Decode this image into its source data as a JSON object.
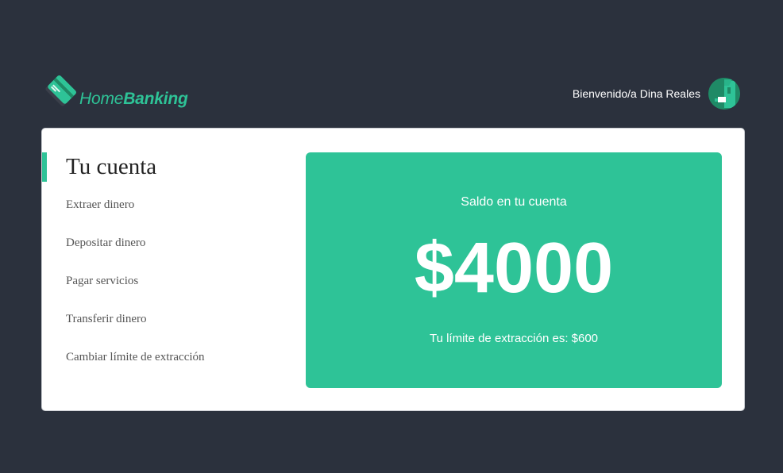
{
  "brand": {
    "name_light": "Home",
    "name_bold": "Banking",
    "accent_color": "#2ec397",
    "logo_icon": "credit-card-icon"
  },
  "header": {
    "welcome_text": "Bienvenido/a Dina Reales",
    "avatar_icon": "user-avatar-icon"
  },
  "menu": {
    "title": "Tu cuenta",
    "items": [
      {
        "label": "Extraer dinero"
      },
      {
        "label": "Depositar dinero"
      },
      {
        "label": "Pagar servicios"
      },
      {
        "label": "Transferir dinero"
      },
      {
        "label": "Cambiar límite de extracción"
      }
    ]
  },
  "account": {
    "balance_label": "Saldo en tu cuenta",
    "balance_amount": "$4000",
    "limit_text": "Tu límite de extracción es: $600"
  },
  "colors": {
    "background": "#2b313d",
    "card": "#ffffff",
    "accent": "#2ec397"
  }
}
